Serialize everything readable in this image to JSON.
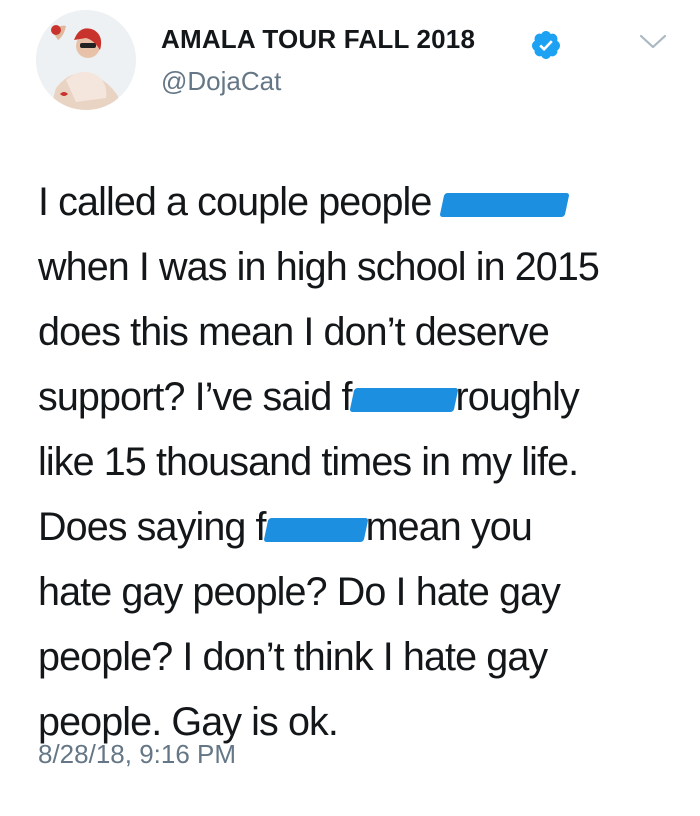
{
  "author": {
    "display_name": "AMALA TOUR FALL 2018",
    "handle": "@DojaCat",
    "verified": true,
    "avatar_icon": "profile-photo"
  },
  "menu": {
    "icon": "chevron-down-icon"
  },
  "tweet": {
    "lines": [
      {
        "before": "I called a couple people ",
        "redacted": true,
        "after": ""
      },
      {
        "before": "when I was in high school in 2015",
        "redacted": false,
        "after": ""
      },
      {
        "before": "does this mean I don’t deserve",
        "redacted": false,
        "after": ""
      },
      {
        "before": "support? I’ve said f",
        "redacted": true,
        "after": "roughly"
      },
      {
        "before": "like 15 thousand times in my life.",
        "redacted": false,
        "after": ""
      },
      {
        "before": "Does saying f",
        "redacted": true,
        "after": "mean you"
      },
      {
        "before": "hate gay people? Do I hate gay",
        "redacted": false,
        "after": ""
      },
      {
        "before": "people? I don’t think I hate gay",
        "redacted": false,
        "after": ""
      },
      {
        "before": "people. Gay is ok.",
        "redacted": false,
        "after": ""
      }
    ],
    "timestamp": "8/28/18, 9:16 PM"
  },
  "colors": {
    "text": "#14171a",
    "secondary": "#657786",
    "verified_blue": "#1da1f2",
    "redaction_blue": "#1d8fe1"
  }
}
